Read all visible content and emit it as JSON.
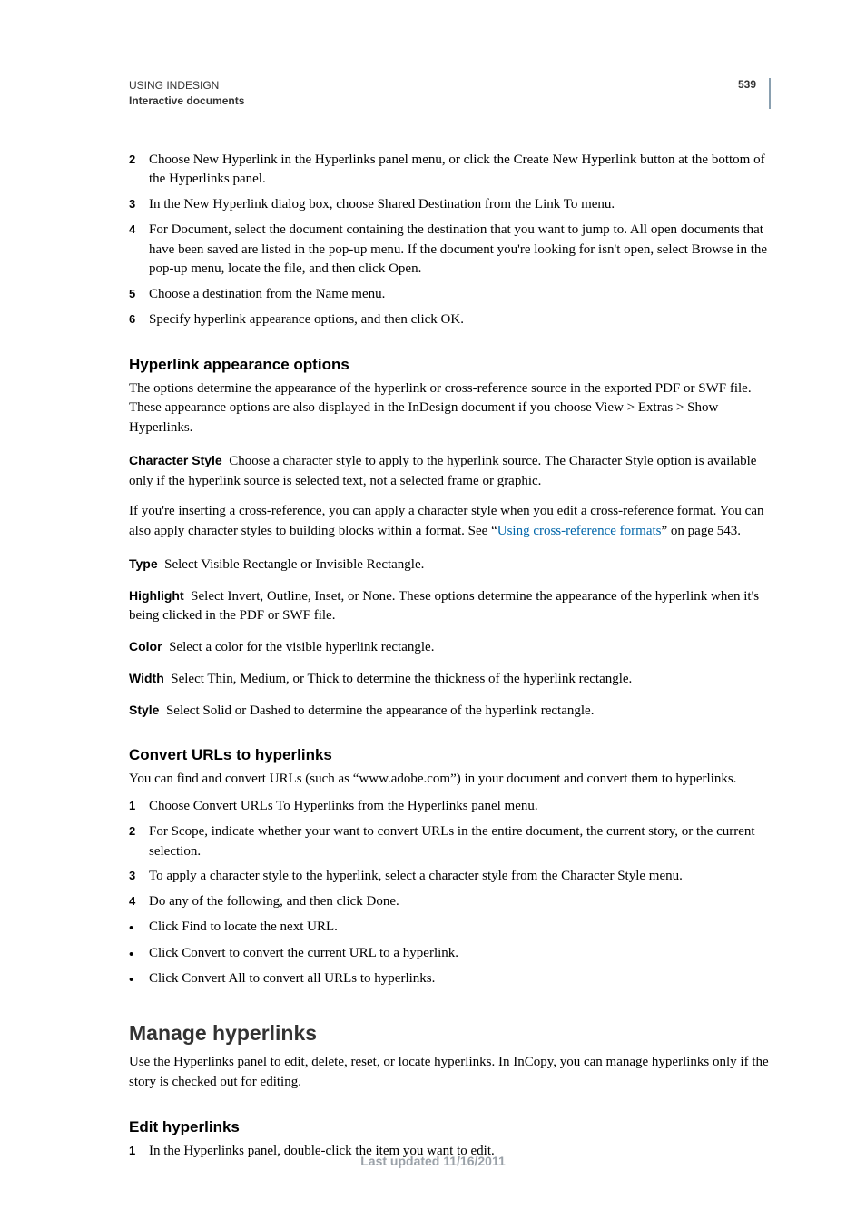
{
  "header": {
    "title": "USING INDESIGN",
    "subtitle": "Interactive documents",
    "page_number": "539"
  },
  "steps_top": [
    "Choose New Hyperlink in the Hyperlinks panel menu, or click the Create New Hyperlink button at the bottom of the Hyperlinks panel.",
    "In the New Hyperlink dialog box, choose Shared Destination from the Link To menu.",
    "For Document, select the document containing the destination that you want to jump to. All open documents that have been saved are listed in the pop-up menu. If the document you're looking for isn't open, select Browse in the pop-up menu, locate the file, and then click Open.",
    "Choose a destination from the Name menu.",
    "Specify hyperlink appearance options, and then click OK."
  ],
  "steps_top_start": 2,
  "sect_appearance": {
    "heading": "Hyperlink appearance options",
    "intro": "The options determine the appearance of the hyperlink or cross-reference source in the exported PDF or SWF file. These appearance options are also displayed in the InDesign document if you choose View > Extras > Show Hyperlinks.",
    "char_style_term": "Character Style",
    "char_style_body": "Choose a character style to apply to the hyperlink source. The Character Style option is available only if the hyperlink source is selected text, not a selected frame or graphic.",
    "xref_para_pre": "If you're inserting a cross-reference, you can apply a character style when you edit a cross-reference format. You can also apply character styles to building blocks within a format. See “",
    "xref_link_text": "Using cross-reference formats",
    "xref_para_post": "” on page 543.",
    "defs": [
      {
        "term": "Type",
        "body": "Select Visible Rectangle or Invisible Rectangle."
      },
      {
        "term": "Highlight",
        "body": "Select Invert, Outline, Inset, or None. These options determine the appearance of the hyperlink when it's being clicked in the PDF or SWF file."
      },
      {
        "term": "Color",
        "body": "Select a color for the visible hyperlink rectangle."
      },
      {
        "term": "Width",
        "body": "Select Thin, Medium, or Thick to determine the thickness of the hyperlink rectangle."
      },
      {
        "term": "Style",
        "body": "Select Solid or Dashed to determine the appearance of the hyperlink rectangle."
      }
    ]
  },
  "sect_convert": {
    "heading": "Convert URLs to hyperlinks",
    "intro": "You can find and convert URLs (such as “www.adobe.com”) in your document and convert them to hyperlinks.",
    "steps": [
      "Choose Convert URLs To Hyperlinks from the Hyperlinks panel menu.",
      "For Scope, indicate whether your want to convert URLs in the entire document, the current story, or the current selection.",
      "To apply a character style to the hyperlink, select a character style from the Character Style menu.",
      "Do any of the following, and then click Done."
    ],
    "bullets": [
      "Click Find to locate the next URL.",
      "Click Convert to convert the current URL to a hyperlink.",
      "Click Convert All to convert all URLs to hyperlinks."
    ]
  },
  "sect_manage": {
    "heading": "Manage hyperlinks",
    "intro": "Use the Hyperlinks panel to edit, delete, reset, or locate hyperlinks. In InCopy, you can manage hyperlinks only if the story is checked out for editing."
  },
  "sect_edit": {
    "heading": "Edit hyperlinks",
    "steps": [
      "In the Hyperlinks panel, double-click the item you want to edit."
    ]
  },
  "footer": "Last updated 11/16/2011"
}
